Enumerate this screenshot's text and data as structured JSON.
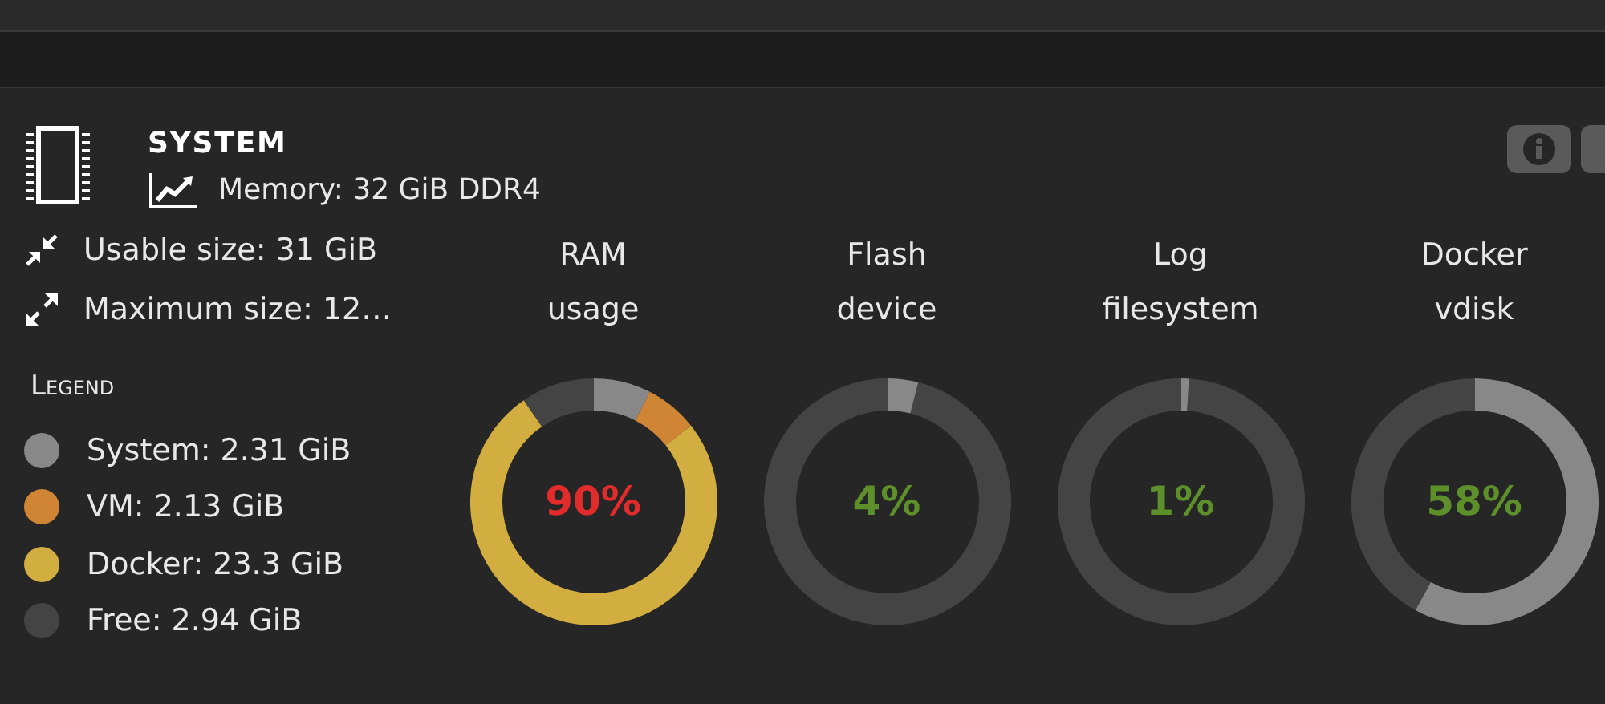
{
  "panel": {
    "title": "SYSTEM",
    "subtitle": "Memory: 32 GiB DDR4"
  },
  "sizes": [
    {
      "kind": "shrink",
      "text": "Usable size: 31 GiB"
    },
    {
      "kind": "expand",
      "text": "Maximum size: 12…"
    }
  ],
  "legend": {
    "heading": "Legend",
    "items": [
      {
        "label": "System: 2.31 GiB",
        "color": "#888888"
      },
      {
        "label": "VM: 2.13 GiB",
        "color": "#d08535"
      },
      {
        "label": "Docker: 23.3 GiB",
        "color": "#d2ad40"
      },
      {
        "label": "Free: 2.94 GiB",
        "color": "#444444"
      }
    ]
  },
  "gauges": [
    {
      "title": "RAM usage",
      "percent": "90%",
      "alert": true
    },
    {
      "title": "Flash device",
      "percent": "4%",
      "alert": false
    },
    {
      "title": "Log filesystem",
      "percent": "1%",
      "alert": false
    },
    {
      "title": "Docker vdisk",
      "percent": "58%",
      "alert": false
    }
  ]
}
